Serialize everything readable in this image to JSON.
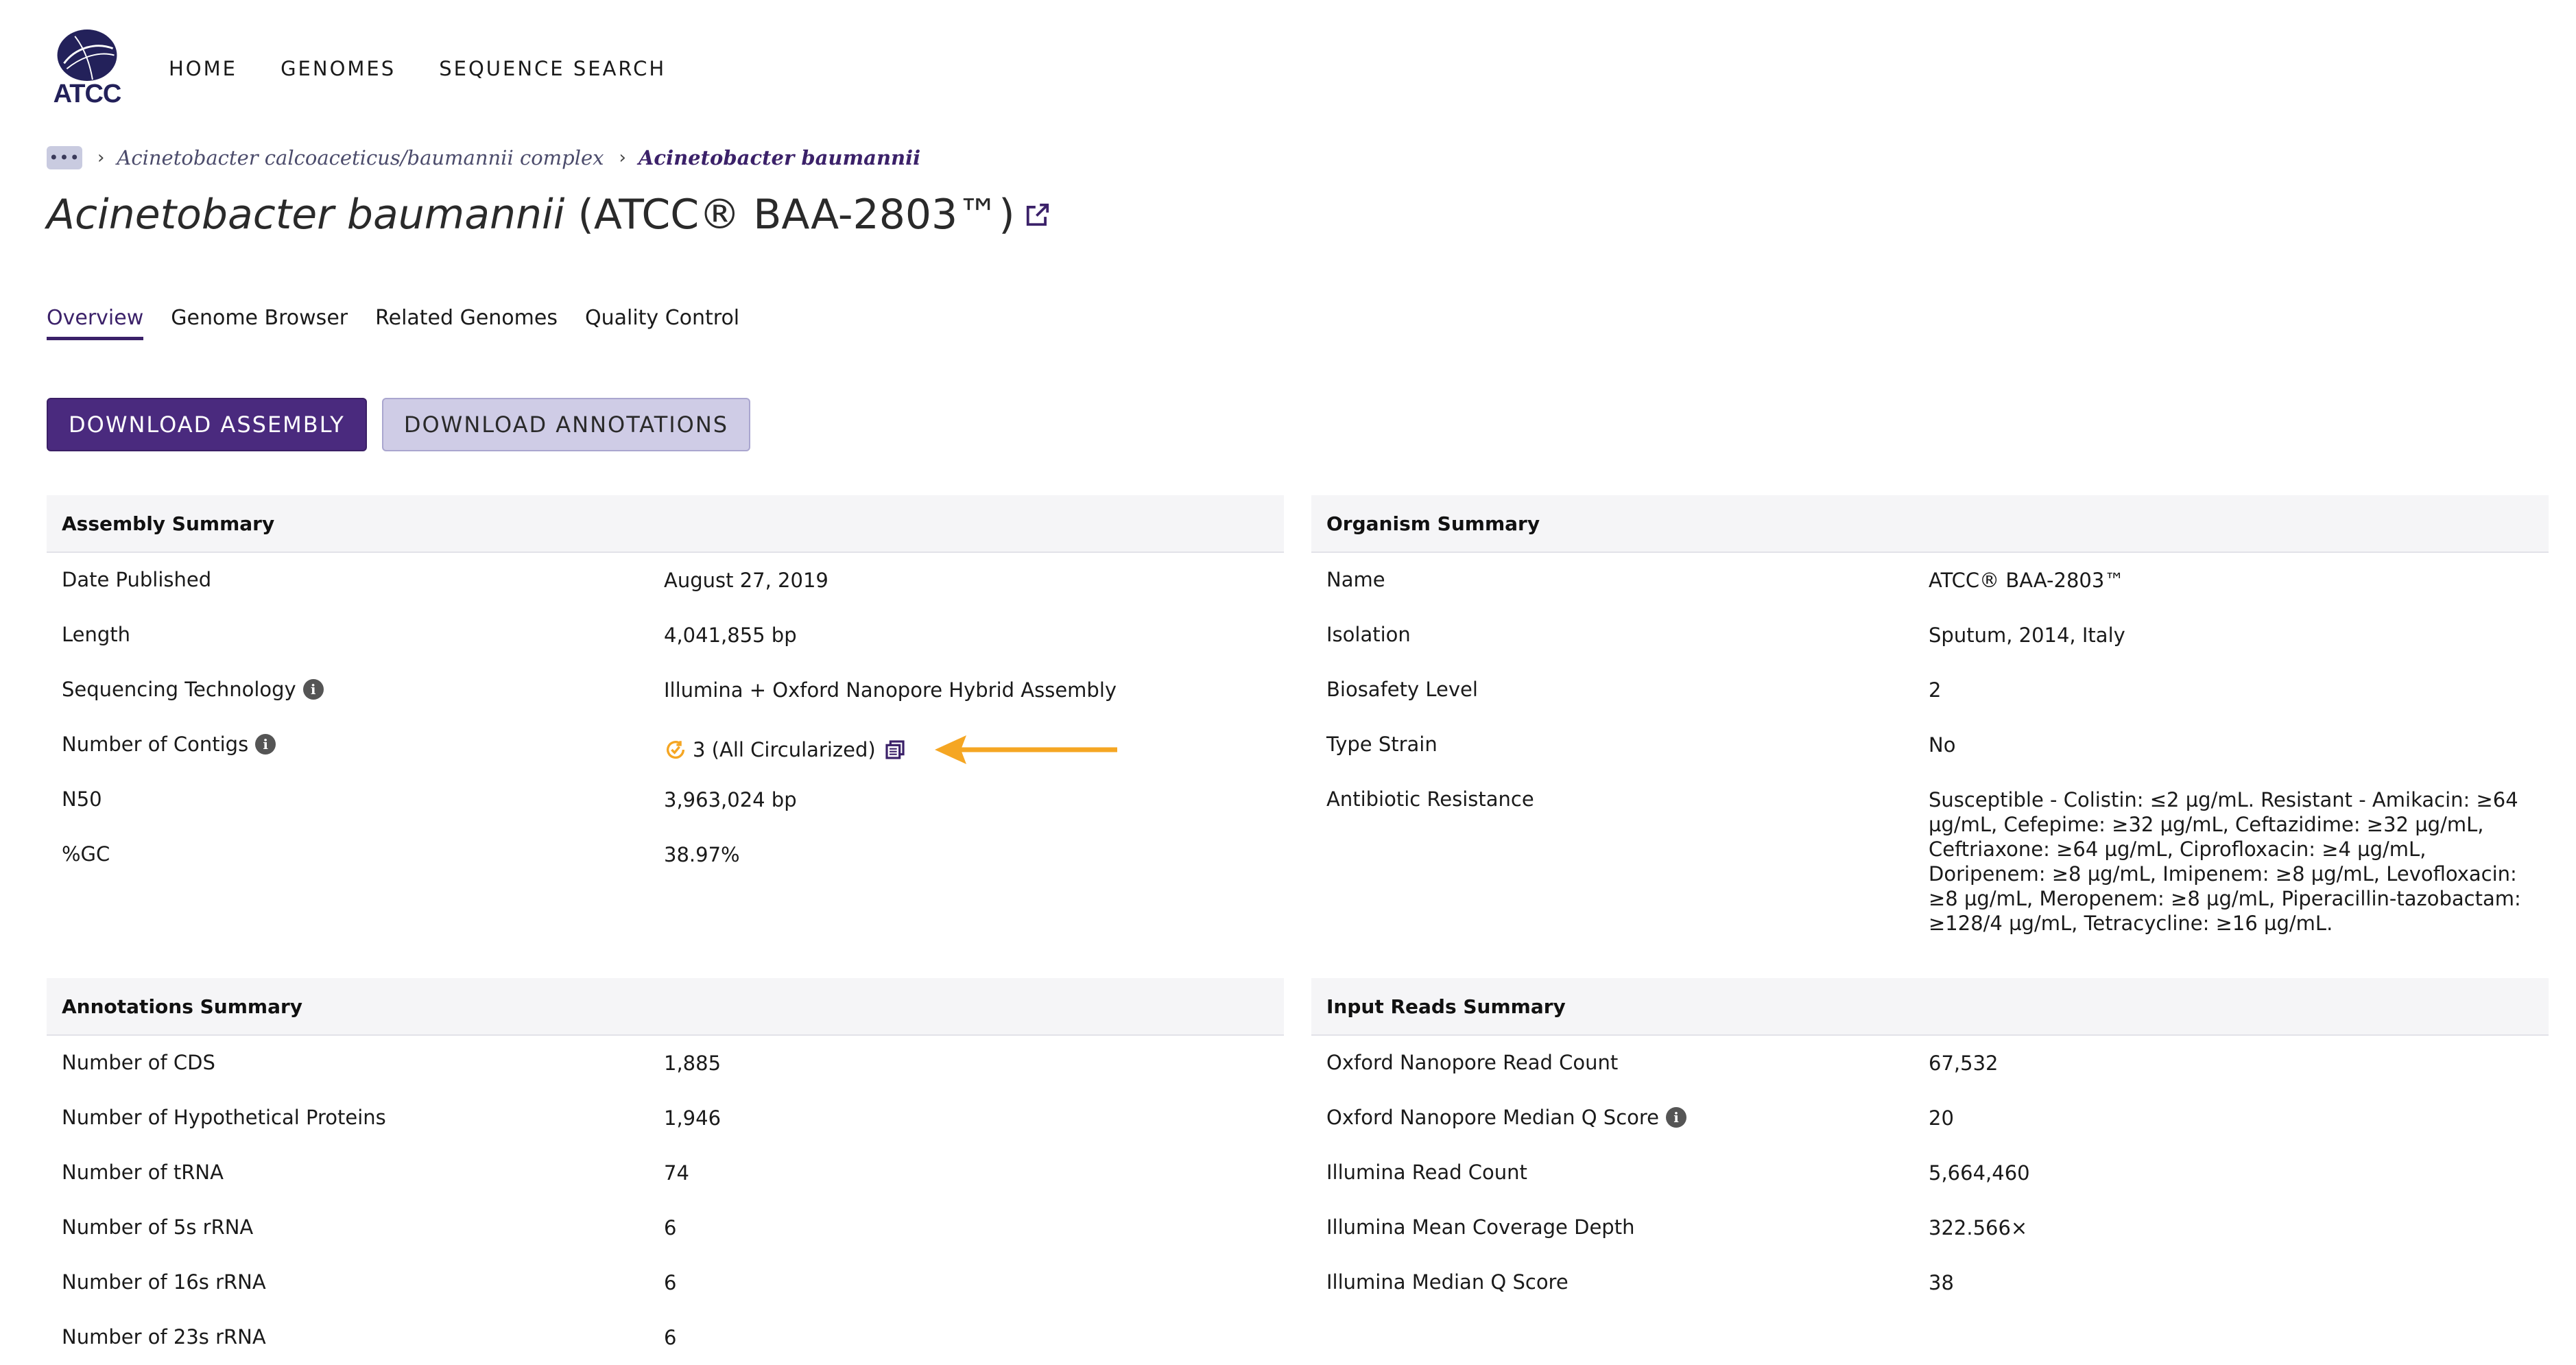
{
  "header": {
    "logo_text": "ATCC",
    "nav": [
      "HOME",
      "GENOMES",
      "SEQUENCE SEARCH"
    ]
  },
  "breadcrumb": {
    "more": "•••",
    "items": [
      "Acinetobacter calcoaceticus/baumannii complex",
      "Acinetobacter baumannii"
    ]
  },
  "title": {
    "species": "Acinetobacter baumannii",
    "strain": "(ATCC® BAA-2803™)"
  },
  "tabs": [
    "Overview",
    "Genome Browser",
    "Related Genomes",
    "Quality Control"
  ],
  "buttons": {
    "download_assembly": "DOWNLOAD ASSEMBLY",
    "download_annotations": "DOWNLOAD ANNOTATIONS"
  },
  "assembly_summary": {
    "title": "Assembly Summary",
    "rows": [
      {
        "label": "Date Published",
        "value": "August 27, 2019"
      },
      {
        "label": "Length",
        "value": "4,041,855 bp"
      },
      {
        "label": "Sequencing Technology",
        "value": "Illumina + Oxford Nanopore Hybrid Assembly"
      },
      {
        "label": "Number of Contigs",
        "value": "3 (All Circularized)"
      },
      {
        "label": "N50",
        "value": "3,963,024 bp"
      },
      {
        "label": "%GC",
        "value": "38.97%"
      }
    ]
  },
  "organism_summary": {
    "title": "Organism Summary",
    "rows": [
      {
        "label": "Name",
        "value": "ATCC® BAA-2803™"
      },
      {
        "label": "Isolation",
        "value": "Sputum, 2014, Italy"
      },
      {
        "label": "Biosafety Level",
        "value": "2"
      },
      {
        "label": "Type Strain",
        "value": "No"
      },
      {
        "label": "Antibiotic Resistance",
        "value": "Susceptible - Colistin: ≤2 µg/mL. Resistant - Amikacin: ≥64 µg/mL, Cefepime: ≥32 µg/mL, Ceftazidime: ≥32 µg/mL, Ceftriaxone: ≥64 µg/mL, Ciprofloxacin: ≥4 µg/mL, Doripenem: ≥8 µg/mL, Imipenem: ≥8 µg/mL, Levofloxacin: ≥8 µg/mL, Meropenem: ≥8 µg/mL, Piperacillin-tazobactam: ≥128/4 µg/mL, Tetracycline: ≥16 µg/mL."
      }
    ]
  },
  "annotations_summary": {
    "title": "Annotations Summary",
    "rows": [
      {
        "label": "Number of CDS",
        "value": "1,885"
      },
      {
        "label": "Number of Hypothetical Proteins",
        "value": "1,946"
      },
      {
        "label": "Number of tRNA",
        "value": "74"
      },
      {
        "label": "Number of 5s rRNA",
        "value": "6"
      },
      {
        "label": "Number of 16s rRNA",
        "value": "6"
      },
      {
        "label": "Number of 23s rRNA",
        "value": "6"
      }
    ]
  },
  "input_reads_summary": {
    "title": "Input Reads Summary",
    "rows": [
      {
        "label": "Oxford Nanopore Read Count",
        "value": "67,532"
      },
      {
        "label": "Oxford Nanopore Median Q Score",
        "value": "20"
      },
      {
        "label": "Illumina Read Count",
        "value": "5,664,460"
      },
      {
        "label": "Illumina Mean Coverage Depth",
        "value": "322.566×"
      },
      {
        "label": "Illumina Median Q Score",
        "value": "38"
      }
    ]
  },
  "colors": {
    "brand_purple": "#4a2a7e",
    "accent_orange": "#f5a623",
    "logo_navy": "#23215a"
  }
}
